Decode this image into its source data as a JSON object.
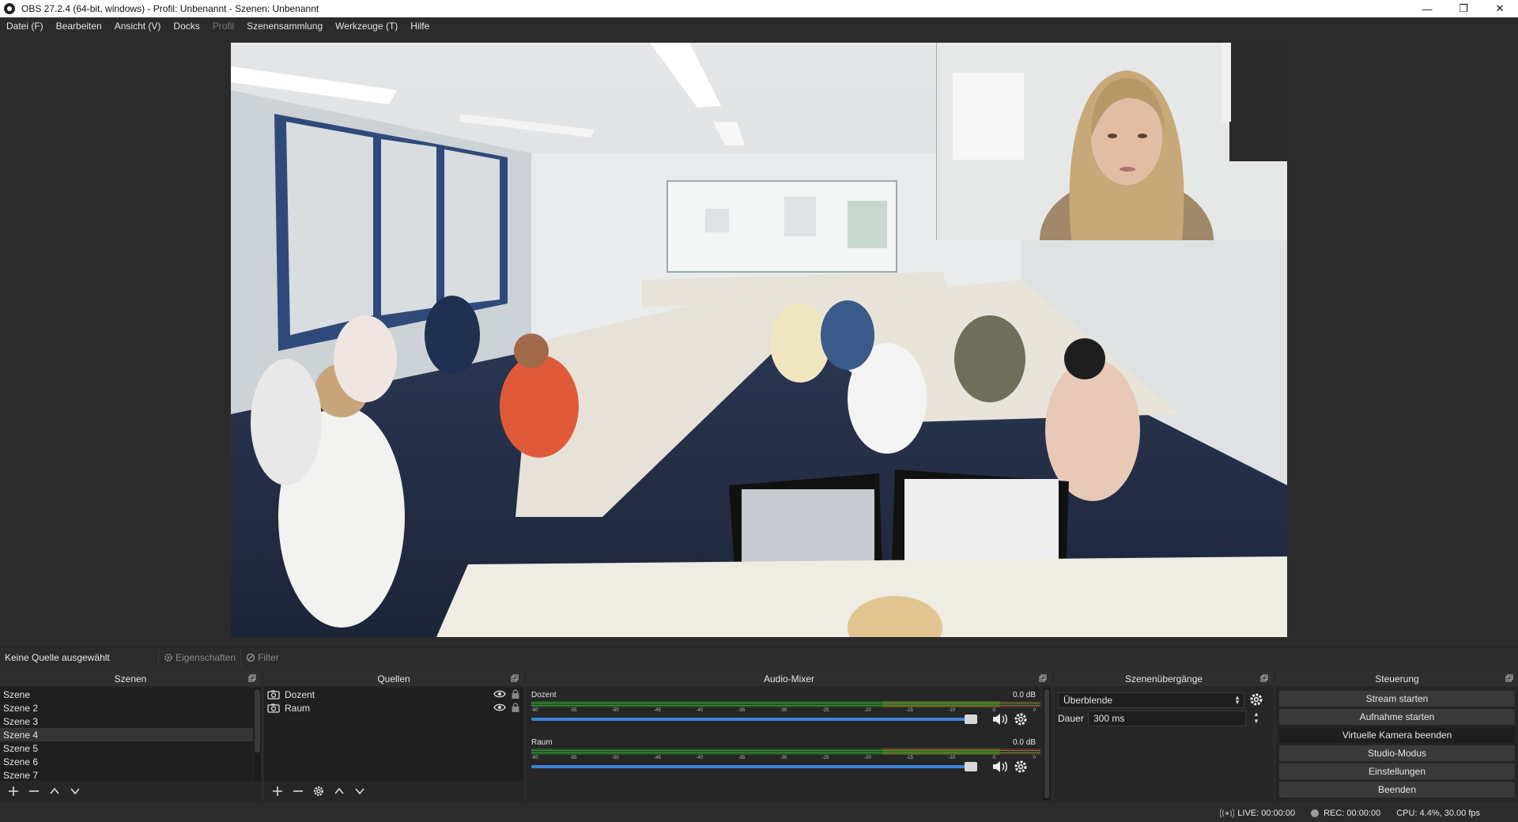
{
  "window": {
    "title": "OBS 27.2.4 (64-bit, windows) - Profil: Unbenannt - Szenen: Unbenannt",
    "min": "—",
    "max": "❐",
    "close": "✕"
  },
  "menu": [
    {
      "label": "Datei (F)",
      "disabled": false
    },
    {
      "label": "Bearbeiten",
      "disabled": false
    },
    {
      "label": "Ansicht (V)",
      "disabled": false
    },
    {
      "label": "Docks",
      "disabled": false
    },
    {
      "label": "Profil",
      "disabled": true
    },
    {
      "label": "Szenensammlung",
      "disabled": false
    },
    {
      "label": "Werkzeuge (T)",
      "disabled": false
    },
    {
      "label": "Hilfe",
      "disabled": false
    }
  ],
  "sourcebar": {
    "no_source": "Keine Quelle ausgewählt",
    "properties": "Eigenschaften",
    "filter": "Filter"
  },
  "scenes": {
    "title": "Szenen",
    "items": [
      "Szene",
      "Szene 2",
      "Szene 3",
      "Szene 4",
      "Szene 5",
      "Szene 6",
      "Szene 7"
    ],
    "selected_index": 3
  },
  "sources": {
    "title": "Quellen",
    "items": [
      "Dozent",
      "Raum"
    ]
  },
  "mixer": {
    "title": "Audio-Mixer",
    "scale": [
      "-60",
      "-55",
      "-50",
      "-45",
      "-40",
      "-35",
      "-30",
      "-25",
      "-20",
      "-15",
      "-10",
      "-5",
      "0"
    ],
    "channels": [
      {
        "name": "Dozent",
        "db": "0.0 dB",
        "volume": 1.0
      },
      {
        "name": "Raum",
        "db": "0.0 dB",
        "volume": 1.0
      }
    ]
  },
  "transitions": {
    "title": "Szenenübergänge",
    "selected": "Überblende",
    "duration_label": "Dauer",
    "duration_value": "300 ms"
  },
  "controls": {
    "title": "Steuerung",
    "buttons": [
      {
        "label": "Stream starten",
        "active": false
      },
      {
        "label": "Aufnahme starten",
        "active": false
      },
      {
        "label": "Virtuelle Kamera beenden",
        "active": true
      },
      {
        "label": "Studio-Modus",
        "active": false
      },
      {
        "label": "Einstellungen",
        "active": false
      },
      {
        "label": "Beenden",
        "active": false
      }
    ]
  },
  "status": {
    "live": "LIVE: 00:00:00",
    "rec": "REC: 00:00:00",
    "cpu": "CPU: 4.4%, 30.00 fps"
  },
  "colors": {
    "accent": "#3b83d6",
    "meter_green": "#2f9e2f",
    "meter_yellow": "#c8b82a",
    "meter_red": "#c83030"
  }
}
